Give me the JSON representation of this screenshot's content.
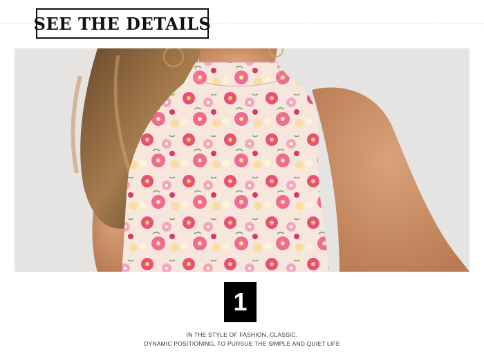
{
  "header": {
    "title": "SEE THE DETAILS"
  },
  "photo": {
    "description_icon": "floral-top-photo"
  },
  "detail": {
    "number": "1",
    "caption_line1": "IN THE STYLE OF FASHION, CLASSIC,",
    "caption_line2": "DYNAMIC POSITIONING, TO PURSUE THE SIMPLE AND QUIET LIFE"
  },
  "colors": {
    "background": "#ffffff",
    "photo_bg": "#e6e4e3",
    "accent_pink": "#e8507a",
    "badge": "#000000"
  }
}
